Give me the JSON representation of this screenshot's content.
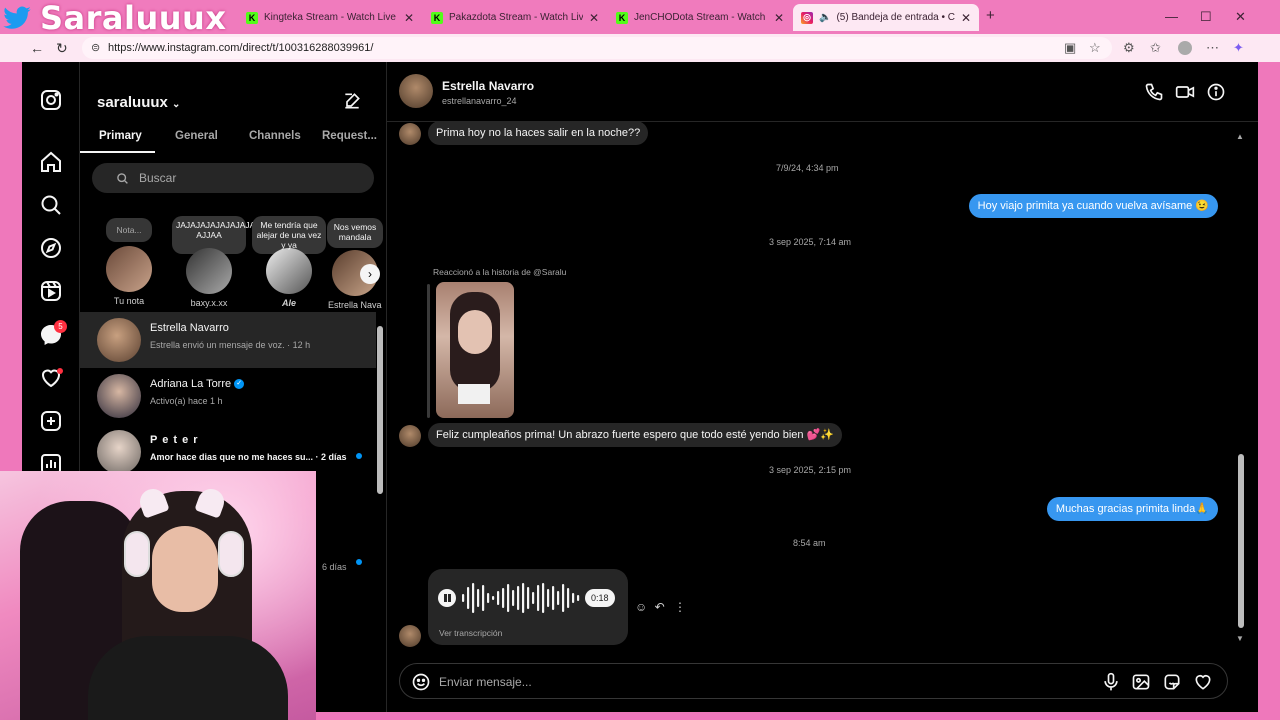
{
  "browser": {
    "brand_text": "Saraluuux",
    "tabs": [
      {
        "title": "Kingteka Stream - Watch Live on",
        "favicon": "kick-icon"
      },
      {
        "title": "Pakazdota Stream - Watch Live on",
        "favicon": "kick-icon"
      },
      {
        "title": "JenCHODota Stream - Watch Live on",
        "favicon": "kick-icon"
      },
      {
        "title": "(5) Bandeja de entrada • Chats",
        "favicon": "instagram-icon"
      }
    ],
    "url": "https://www.instagram.com/direct/t/100316288039961/",
    "accent_color": "#f07bbd"
  },
  "inbox": {
    "username": "saraluuux",
    "tabs": [
      "Primary",
      "General",
      "Channels",
      "Request..."
    ],
    "active_tab": "Primary",
    "search_placeholder": "Buscar",
    "notes": [
      {
        "text": "Nota...",
        "name": "Tu nota"
      },
      {
        "text": "JAJAJAJAJAJAJAJAJAJAJAJAJJAJ AJJAA",
        "name": "baxy.x.xx"
      },
      {
        "text": "Me tendría que alejar de una vez y ya",
        "name": "Ale"
      },
      {
        "text": "Nos vemos mandala",
        "name": "Estrella Nava"
      }
    ],
    "threads": [
      {
        "name": "Estrella Navarro",
        "preview": "Estrella envió un mensaje de voz. · 12 h",
        "selected": true
      },
      {
        "name": "Adriana La Torre",
        "preview": "Activo(a) hace 1 h",
        "verified": true
      },
      {
        "name": "P e t e r",
        "preview": "Amor hace dias que no me haces su... · 2 días",
        "unread": true
      },
      {
        "name": "",
        "preview": "6 días",
        "unread": true
      }
    ],
    "unread_badge": "5"
  },
  "chat": {
    "contact_name": "Estrella Navarro",
    "contact_handle": "estrellanavarro_24",
    "messages": [
      {
        "type": "in",
        "text": "Prima hoy no la haces salir en la noche??"
      },
      {
        "type": "time",
        "text": "7/9/24, 4:34 pm"
      },
      {
        "type": "out",
        "text": "Hoy viajo primita ya cuando vuelva avísame 😉"
      },
      {
        "type": "time",
        "text": "3 sep 2025, 7:14 am"
      },
      {
        "type": "story_label",
        "text": "Reaccionó a la historia de @Saralu"
      },
      {
        "type": "in",
        "text": "Feliz cumpleaños prima! Un abrazo fuerte espero que todo esté yendo bien 💕✨"
      },
      {
        "type": "time",
        "text": "3 sep 2025, 2:15 pm"
      },
      {
        "type": "out",
        "text": "Muchas gracias primita linda🙏"
      },
      {
        "type": "time",
        "text": "8:54 am"
      }
    ],
    "voice_note": {
      "duration": "0:18",
      "transcript_link": "Ver transcripción"
    },
    "composer_placeholder": "Enviar mensaje...",
    "bubble_out_color": "#3797f0",
    "bubble_in_color": "#262626"
  }
}
